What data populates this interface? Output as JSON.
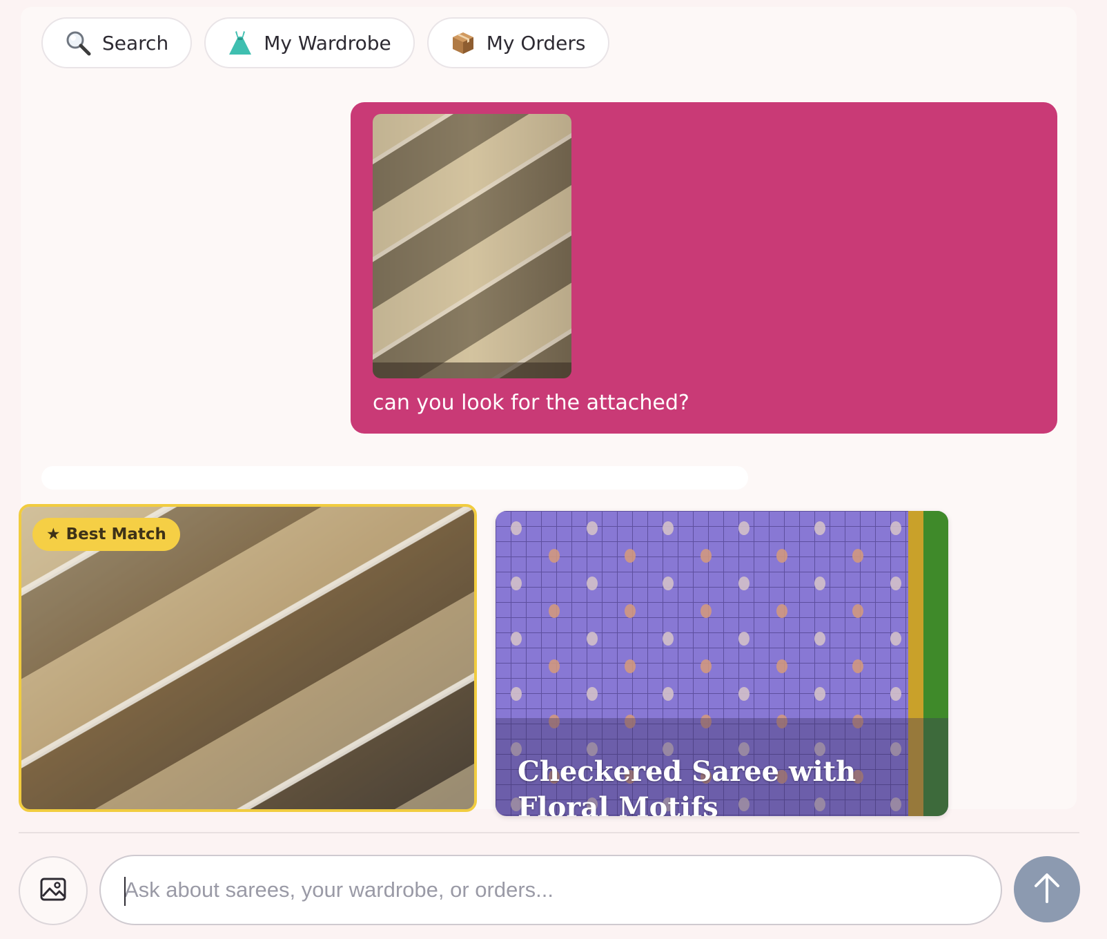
{
  "quick_actions": [
    {
      "icon": "magnifier-icon",
      "label": "Search"
    },
    {
      "icon": "dress-icon",
      "label": "My Wardrobe"
    },
    {
      "icon": "package-icon",
      "label": "My Orders"
    }
  ],
  "user_message": {
    "attachment": "attached-saree-photo",
    "text": "can you look for the attached?"
  },
  "results": [
    {
      "badge": "★ Best Match",
      "title": "",
      "image": "beige-diagonal-floral-saree"
    },
    {
      "badge": "",
      "title": "Checkered Saree with Floral Motifs",
      "image": "lavender-checkered-saree"
    }
  ],
  "composer": {
    "placeholder": "Ask about sarees, your wardrobe, or orders...",
    "value": ""
  },
  "colors": {
    "accent": "#c93a76",
    "badge": "#f5cf45",
    "send_disabled": "#8c9ab0",
    "background": "#fcf3f3"
  }
}
